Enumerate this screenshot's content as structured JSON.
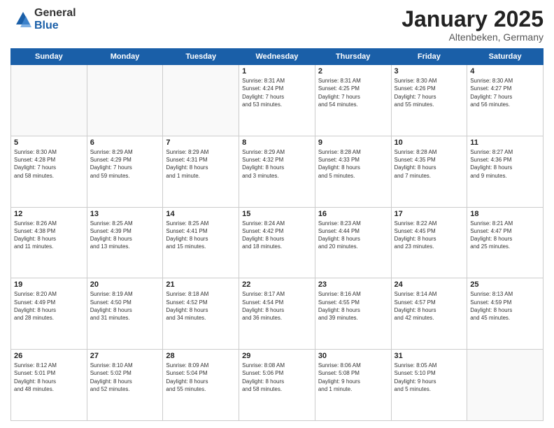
{
  "header": {
    "logo_general": "General",
    "logo_blue": "Blue",
    "month_title": "January 2025",
    "subtitle": "Altenbeken, Germany"
  },
  "weekdays": [
    "Sunday",
    "Monday",
    "Tuesday",
    "Wednesday",
    "Thursday",
    "Friday",
    "Saturday"
  ],
  "weeks": [
    [
      {
        "day": "",
        "info": ""
      },
      {
        "day": "",
        "info": ""
      },
      {
        "day": "",
        "info": ""
      },
      {
        "day": "1",
        "info": "Sunrise: 8:31 AM\nSunset: 4:24 PM\nDaylight: 7 hours\nand 53 minutes."
      },
      {
        "day": "2",
        "info": "Sunrise: 8:31 AM\nSunset: 4:25 PM\nDaylight: 7 hours\nand 54 minutes."
      },
      {
        "day": "3",
        "info": "Sunrise: 8:30 AM\nSunset: 4:26 PM\nDaylight: 7 hours\nand 55 minutes."
      },
      {
        "day": "4",
        "info": "Sunrise: 8:30 AM\nSunset: 4:27 PM\nDaylight: 7 hours\nand 56 minutes."
      }
    ],
    [
      {
        "day": "5",
        "info": "Sunrise: 8:30 AM\nSunset: 4:28 PM\nDaylight: 7 hours\nand 58 minutes."
      },
      {
        "day": "6",
        "info": "Sunrise: 8:29 AM\nSunset: 4:29 PM\nDaylight: 7 hours\nand 59 minutes."
      },
      {
        "day": "7",
        "info": "Sunrise: 8:29 AM\nSunset: 4:31 PM\nDaylight: 8 hours\nand 1 minute."
      },
      {
        "day": "8",
        "info": "Sunrise: 8:29 AM\nSunset: 4:32 PM\nDaylight: 8 hours\nand 3 minutes."
      },
      {
        "day": "9",
        "info": "Sunrise: 8:28 AM\nSunset: 4:33 PM\nDaylight: 8 hours\nand 5 minutes."
      },
      {
        "day": "10",
        "info": "Sunrise: 8:28 AM\nSunset: 4:35 PM\nDaylight: 8 hours\nand 7 minutes."
      },
      {
        "day": "11",
        "info": "Sunrise: 8:27 AM\nSunset: 4:36 PM\nDaylight: 8 hours\nand 9 minutes."
      }
    ],
    [
      {
        "day": "12",
        "info": "Sunrise: 8:26 AM\nSunset: 4:38 PM\nDaylight: 8 hours\nand 11 minutes."
      },
      {
        "day": "13",
        "info": "Sunrise: 8:25 AM\nSunset: 4:39 PM\nDaylight: 8 hours\nand 13 minutes."
      },
      {
        "day": "14",
        "info": "Sunrise: 8:25 AM\nSunset: 4:41 PM\nDaylight: 8 hours\nand 15 minutes."
      },
      {
        "day": "15",
        "info": "Sunrise: 8:24 AM\nSunset: 4:42 PM\nDaylight: 8 hours\nand 18 minutes."
      },
      {
        "day": "16",
        "info": "Sunrise: 8:23 AM\nSunset: 4:44 PM\nDaylight: 8 hours\nand 20 minutes."
      },
      {
        "day": "17",
        "info": "Sunrise: 8:22 AM\nSunset: 4:45 PM\nDaylight: 8 hours\nand 23 minutes."
      },
      {
        "day": "18",
        "info": "Sunrise: 8:21 AM\nSunset: 4:47 PM\nDaylight: 8 hours\nand 25 minutes."
      }
    ],
    [
      {
        "day": "19",
        "info": "Sunrise: 8:20 AM\nSunset: 4:49 PM\nDaylight: 8 hours\nand 28 minutes."
      },
      {
        "day": "20",
        "info": "Sunrise: 8:19 AM\nSunset: 4:50 PM\nDaylight: 8 hours\nand 31 minutes."
      },
      {
        "day": "21",
        "info": "Sunrise: 8:18 AM\nSunset: 4:52 PM\nDaylight: 8 hours\nand 34 minutes."
      },
      {
        "day": "22",
        "info": "Sunrise: 8:17 AM\nSunset: 4:54 PM\nDaylight: 8 hours\nand 36 minutes."
      },
      {
        "day": "23",
        "info": "Sunrise: 8:16 AM\nSunset: 4:55 PM\nDaylight: 8 hours\nand 39 minutes."
      },
      {
        "day": "24",
        "info": "Sunrise: 8:14 AM\nSunset: 4:57 PM\nDaylight: 8 hours\nand 42 minutes."
      },
      {
        "day": "25",
        "info": "Sunrise: 8:13 AM\nSunset: 4:59 PM\nDaylight: 8 hours\nand 45 minutes."
      }
    ],
    [
      {
        "day": "26",
        "info": "Sunrise: 8:12 AM\nSunset: 5:01 PM\nDaylight: 8 hours\nand 48 minutes."
      },
      {
        "day": "27",
        "info": "Sunrise: 8:10 AM\nSunset: 5:02 PM\nDaylight: 8 hours\nand 52 minutes."
      },
      {
        "day": "28",
        "info": "Sunrise: 8:09 AM\nSunset: 5:04 PM\nDaylight: 8 hours\nand 55 minutes."
      },
      {
        "day": "29",
        "info": "Sunrise: 8:08 AM\nSunset: 5:06 PM\nDaylight: 8 hours\nand 58 minutes."
      },
      {
        "day": "30",
        "info": "Sunrise: 8:06 AM\nSunset: 5:08 PM\nDaylight: 9 hours\nand 1 minute."
      },
      {
        "day": "31",
        "info": "Sunrise: 8:05 AM\nSunset: 5:10 PM\nDaylight: 9 hours\nand 5 minutes."
      },
      {
        "day": "",
        "info": ""
      }
    ]
  ]
}
